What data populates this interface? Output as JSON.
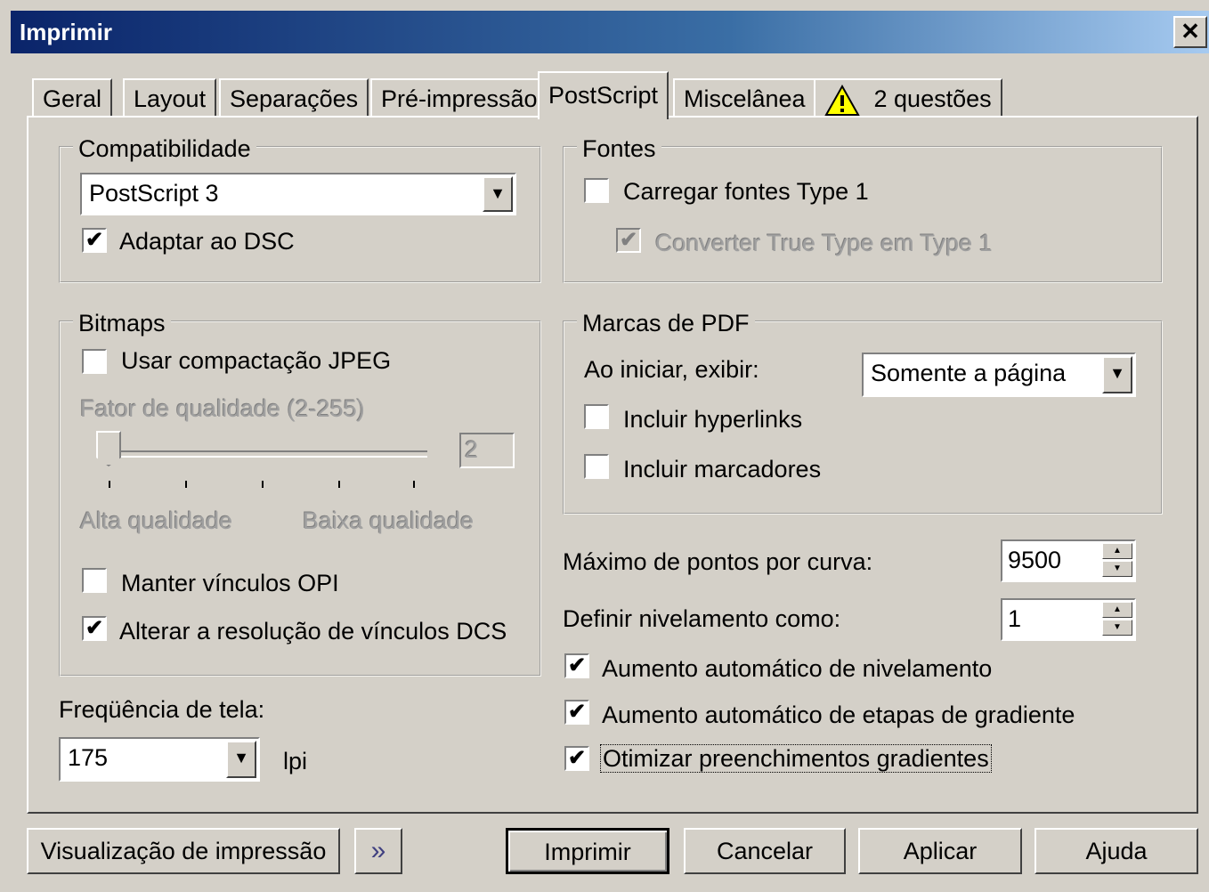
{
  "window": {
    "title": "Imprimir",
    "close_label": "✕"
  },
  "tabs": [
    "Geral",
    "Layout",
    "Separações",
    "Pré-impressão",
    "PostScript",
    "Miscelânea",
    "2 questões"
  ],
  "compat": {
    "legend": "Compatibilidade",
    "selected": "PostScript 3",
    "dsc_label": "Adaptar ao DSC",
    "dsc_checked": "✔"
  },
  "fonts": {
    "legend": "Fontes",
    "load_type1": "Carregar fontes Type 1",
    "convert_tt": "Converter True Type em Type 1",
    "convert_checked": "✔"
  },
  "bitmaps": {
    "legend": "Bitmaps",
    "jpeg": "Usar compactação JPEG",
    "quality_label": "Fator de qualidade (2-255)",
    "quality_value": "2",
    "high": "Alta qualidade",
    "low": "Baixa qualidade",
    "opi": "Manter vínculos OPI",
    "dcs": "Alterar a resolução de vínculos DCS",
    "dcs_checked": "✔"
  },
  "pdf": {
    "legend": "Marcas de PDF",
    "start_label": "Ao iniciar, exibir:",
    "start_value": "Somente a página",
    "hyperlinks": "Incluir hyperlinks",
    "bookmarks": "Incluir marcadores"
  },
  "curve": {
    "label": "Máximo de pontos por curva:",
    "value": "9500"
  },
  "flatness": {
    "label": "Definir nivelamento como:",
    "value": "1"
  },
  "options": {
    "auto_flat": "Aumento automático de nivelamento",
    "auto_grad": "Aumento automático de etapas de gradiente",
    "optimize": "Otimizar preenchimentos gradientes",
    "check": "✔"
  },
  "screen": {
    "label": "Freqüência de tela:",
    "value": "175",
    "unit": "lpi"
  },
  "buttons": {
    "preview": "Visualização de impressão",
    "forward": "»",
    "print": "Imprimir",
    "cancel": "Cancelar",
    "apply": "Aplicar",
    "help": "Ajuda"
  },
  "icons": {
    "arrow": "▼",
    "up": "▲",
    "down": "▼"
  }
}
